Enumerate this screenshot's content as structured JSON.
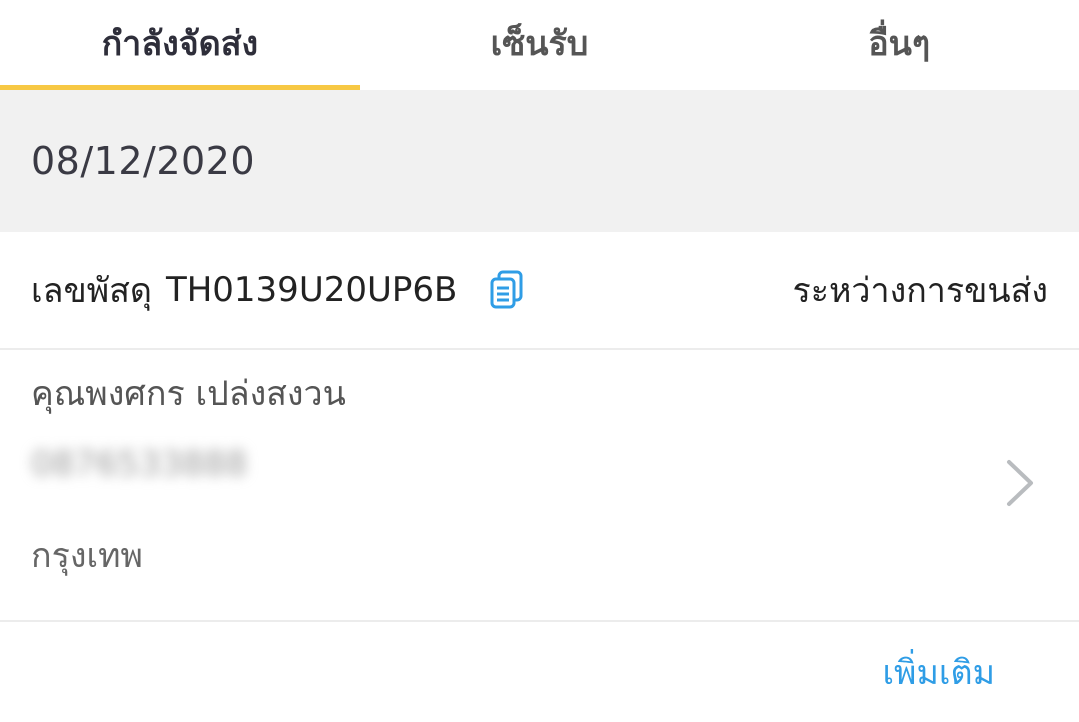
{
  "tabs": [
    {
      "label": "กำลังจัดส่ง",
      "active": true
    },
    {
      "label": "เซ็นรับ",
      "active": false
    },
    {
      "label": "อื่นๆ",
      "active": false
    }
  ],
  "date": "08/12/2020",
  "parcel": {
    "label": "เลขพัสดุ",
    "number": "TH0139U20UP6B",
    "status": "ระหว่างการขนส่ง",
    "copy_icon": "copy-icon"
  },
  "recipient": {
    "name": "คุณพงศกร เปล่งสงวน",
    "phone": "0876533888",
    "city": "กรุงเทพ"
  },
  "footer": {
    "more_label": "เพิ่มเติม"
  },
  "colors": {
    "accent": "#f7c844",
    "link": "#2f9de6",
    "band": "#f1f1f1"
  }
}
